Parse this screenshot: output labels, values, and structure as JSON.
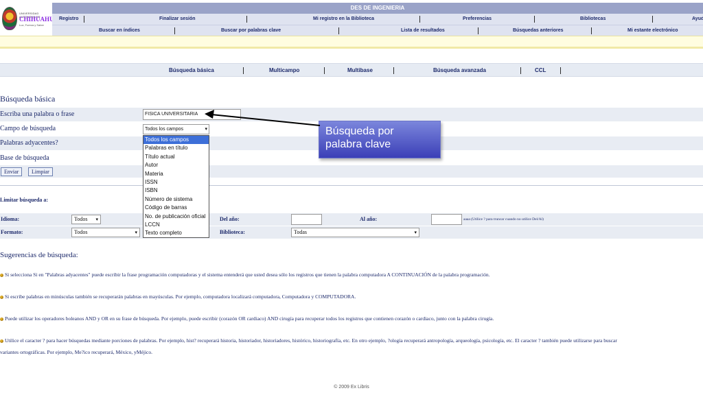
{
  "header": {
    "logo_line1": "UNIVERSIDAD AUTONOMA DE",
    "logo_line2": "CHIHUAHUA",
    "logo_line3": "Luz, Fuerza y Saber",
    "title": "DES DE INGENIERIA",
    "nav1": [
      "Registro",
      "Finalizar sesión",
      "Mi registro en la Biblioteca",
      "Preferencias",
      "Bibliotecas",
      "Ayuda"
    ],
    "nav2": [
      "Buscar en índices",
      "Buscar por palabras clave",
      "Lista de resultados",
      "Búsquedas anteriores",
      "Mi estante electrónico"
    ]
  },
  "tabs": [
    "Búsqueda básica",
    "Multicampo",
    "Multibase",
    "Búsqueda avanzada",
    "CCL"
  ],
  "form": {
    "heading": "Búsqueda básica",
    "phrase_label": "Escriba una palabra o frase",
    "phrase_value": "FISICA UNIVERSITARIA",
    "field_label": "Campo de búsqueda",
    "field_selected": "Todos los campos",
    "adjacent_label": "Palabras adyacentes?",
    "base_label": "Base de búsqueda",
    "submit_label": "Enviar",
    "clear_label": "Limpiar"
  },
  "dropdown_options": [
    "Todos los campos",
    "Palabras en título",
    "Título actual",
    "Autor",
    "Materia",
    "ISSN",
    "ISBN",
    "Número de sistema",
    "Código de barras",
    "No. de publicación oficial",
    "LCCN",
    "Texto completo"
  ],
  "callout": {
    "line1": "Búsqueda por",
    "line2": "palabra clave"
  },
  "limits": {
    "title": "Limitar búsqueda a:",
    "language_label": "Idioma:",
    "language_value": "Todos",
    "format_label": "Formato:",
    "format_value": "Todos",
    "from_year_label": "Del año:",
    "to_year_label": "Al año:",
    "year_note": "aaaa (Utilice ? para truncar cuando no utilice Del/Al)",
    "library_label": "Biblioteca:",
    "library_value": "Todas"
  },
  "suggestions": {
    "title": "Sugerencias de búsqueda:",
    "tip1": "Si selecciona Si en \"Palabras adyacentes\" puede escribir la frase programación computadoras y el sistema entenderá que usted desea sólo los registros que tienen la palabra computadora A CONTINUACIÓN de la palabra programación.",
    "tip2": "Si escribe palabras en minúsculas también se recuperarán palabras en mayúsculas. Por ejemplo, computadora localizará computadora, Computadora y COMPUTADORA.",
    "tip3": "Puede utilizar los operadores boleanos AND y OR en su frase de búsqueda. Por ejemplo, puede escribir (corazón OR cardiaco) AND cirugía para recuperar todos los registros que contienen corazón o cardiaco, junto con la palabra cirugía.",
    "tip4a": "Utilice el caracter ? para hacer búsquedas mediante porciones de palabras. Por ejemplo, hist? recuperará historia, historiador, historiadores, histórico, historiografía, etc. En otro ejemplo, ?ología recuperará antropología, arqueología, psicología, etc. El caracter ? también puede utilizarse para buscar",
    "tip4b": "variantes ortográficas. Por ejemplo, Me?ico recuperará, México, yMéjico."
  },
  "footer": "© 2009 Ex Libris"
}
